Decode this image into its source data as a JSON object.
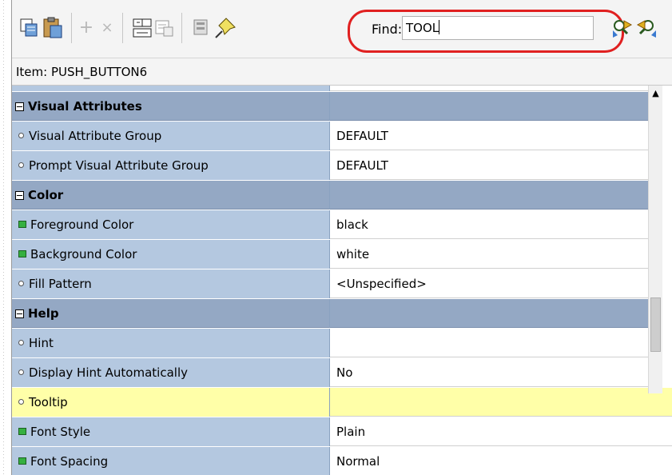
{
  "toolbar": {
    "icons": [
      "copy-properties-icon",
      "paste-properties-icon",
      "add-icon",
      "delete-icon",
      "union-icon",
      "intersection-icon",
      "inherit-icon",
      "freeze-pin-icon",
      "find-next-icon",
      "find-previous-icon"
    ],
    "find_label": "Find:",
    "find_value": "TOOL"
  },
  "item_label": "Item: PUSH_BUTTON6",
  "grid": {
    "rows": [
      {
        "type": "group",
        "label": "Visual Attributes",
        "value": ""
      },
      {
        "type": "prop",
        "marker": "dot",
        "label": "Visual Attribute Group",
        "value": "DEFAULT"
      },
      {
        "type": "prop",
        "marker": "dot",
        "label": "Prompt Visual Attribute Group",
        "value": "DEFAULT"
      },
      {
        "type": "group",
        "label": "Color",
        "value": ""
      },
      {
        "type": "prop",
        "marker": "green",
        "label": "Foreground Color",
        "value": "black"
      },
      {
        "type": "prop",
        "marker": "green",
        "label": "Background Color",
        "value": "white"
      },
      {
        "type": "prop",
        "marker": "dot",
        "label": "Fill Pattern",
        "value": "<Unspecified>"
      },
      {
        "type": "group",
        "label": "Help",
        "value": ""
      },
      {
        "type": "prop",
        "marker": "dot",
        "label": "Hint",
        "value": ""
      },
      {
        "type": "prop",
        "marker": "dot",
        "label": "Display Hint Automatically",
        "value": "No"
      },
      {
        "type": "prop",
        "marker": "dot",
        "label": "Tooltip",
        "value": "",
        "selected": true
      },
      {
        "type": "prop",
        "marker": "green",
        "label": "Font Style",
        "value": "Plain"
      },
      {
        "type": "prop",
        "marker": "green",
        "label": "Font Spacing",
        "value": "Normal"
      }
    ]
  },
  "colors": {
    "group_bg": "#94a8c4",
    "name_bg": "#b4c8e0",
    "selected_bg": "#ffffa8",
    "find_highlight": "#e02020"
  }
}
